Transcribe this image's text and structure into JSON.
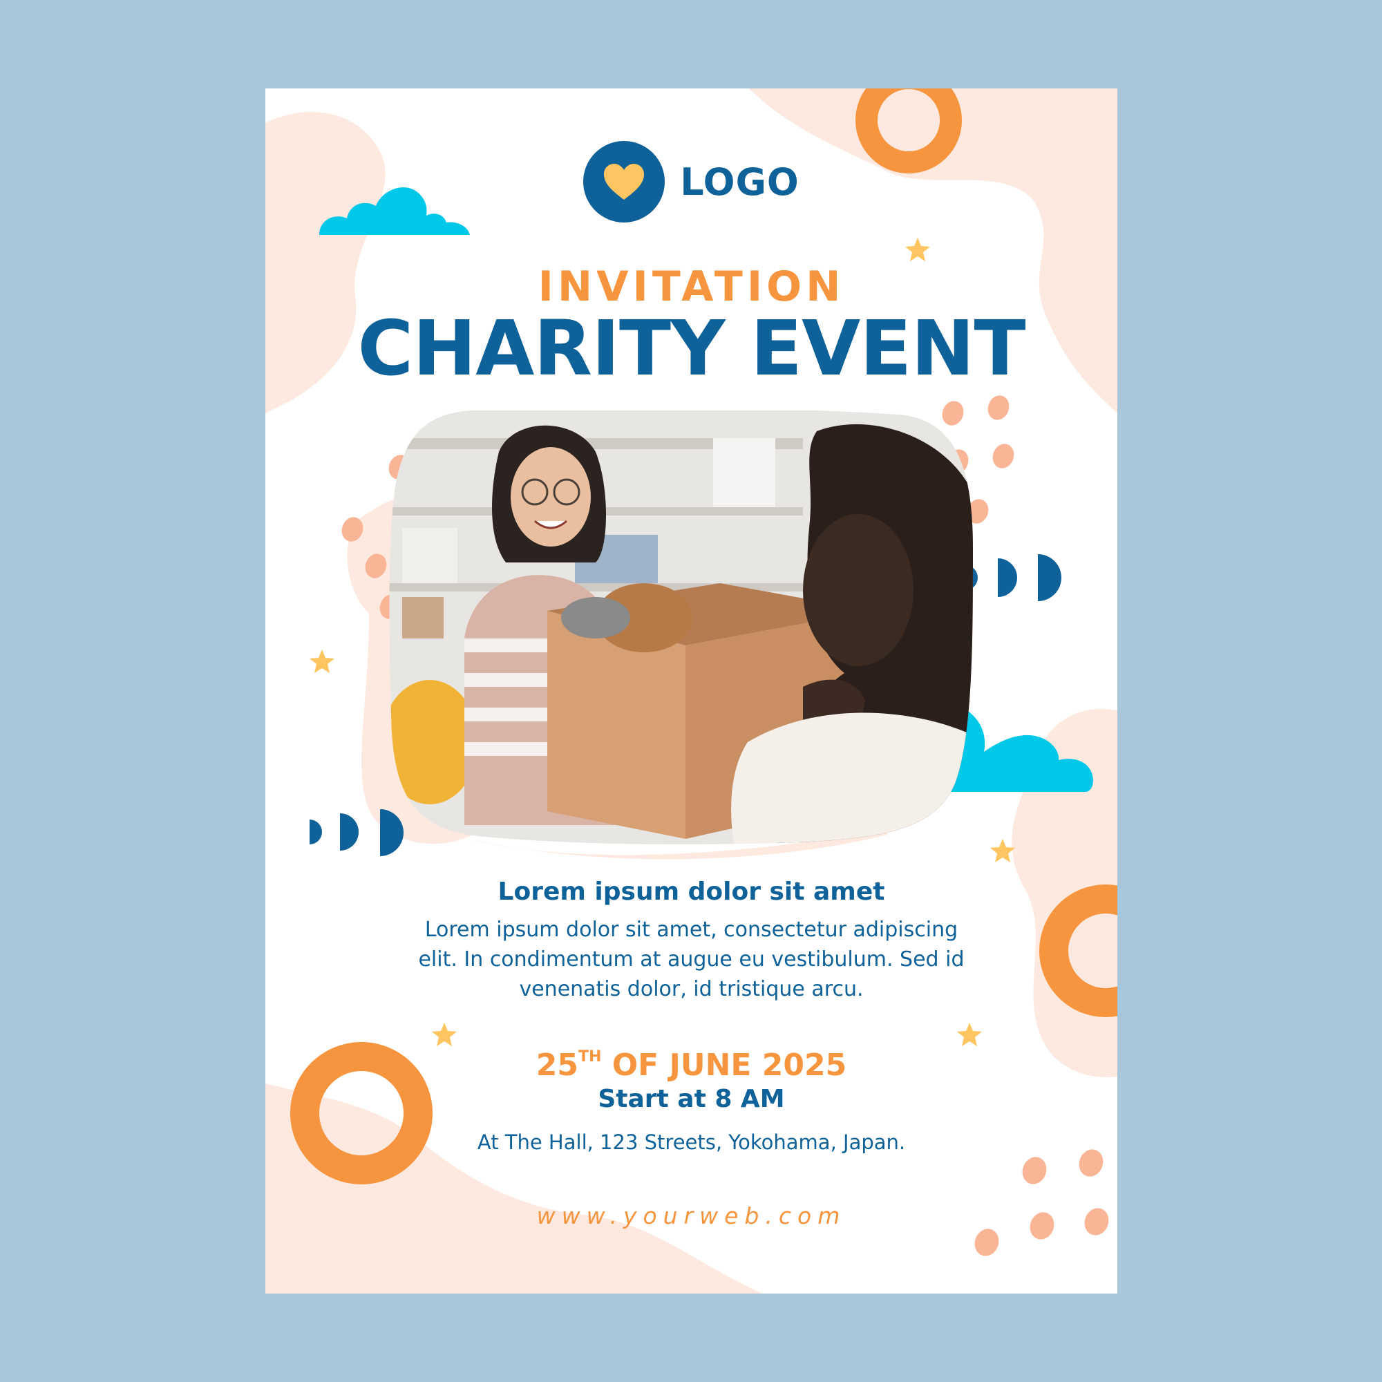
{
  "logo": {
    "text": "LOGO"
  },
  "header": {
    "kicker": "INVITATION",
    "title": "CHARITY EVENT"
  },
  "details": {
    "heading": "Lorem ipsum dolor sit amet",
    "body": "Lorem ipsum dolor sit amet, consectetur adipiscing elit. In condimentum at augue eu vestibulum. Sed id venenatis dolor, id tristique arcu.",
    "date_day": "25",
    "date_suffix": "TH",
    "date_rest": " OF JUNE 2025",
    "start": "Start at 8 AM",
    "address": "At The Hall, 123 Streets, Yokohama, Japan."
  },
  "footer": {
    "website": "www.yourweb.com"
  },
  "colors": {
    "background": "#a9c7db",
    "navy": "#0e6199",
    "orange": "#f6953e",
    "peach": "#fde9df",
    "cyan": "#00c8e8",
    "yellow": "#ffc560"
  }
}
